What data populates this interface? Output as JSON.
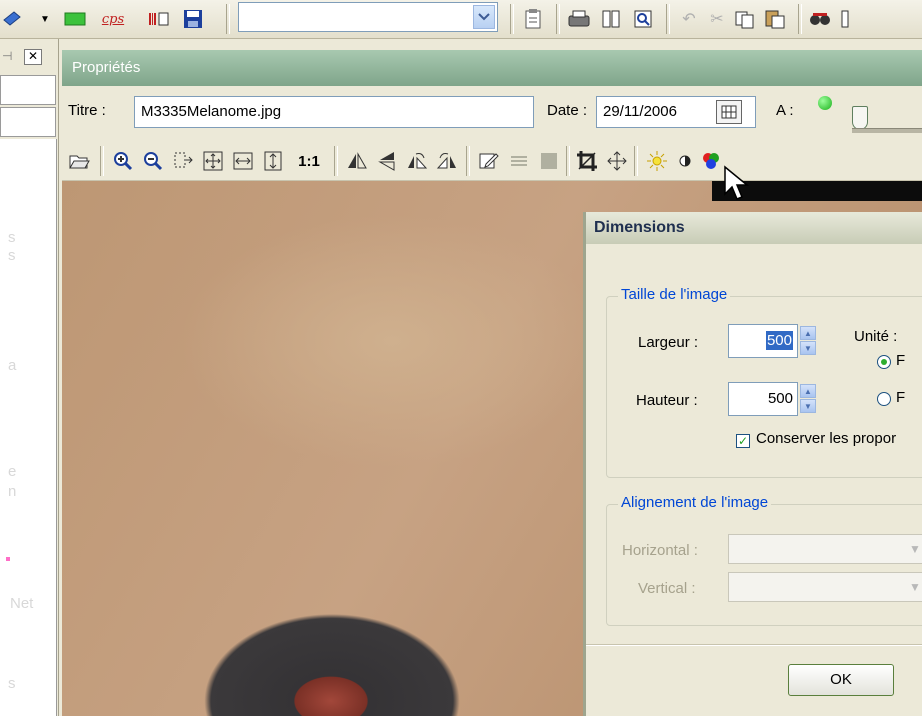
{
  "top_combo": {
    "value": ""
  },
  "properties": {
    "title": "Propriétés",
    "titre_label": "Titre :",
    "titre_value": "M3335Melanome.jpg",
    "date_label": "Date :",
    "date_value": "29/11/2006",
    "a_label": "A :",
    "zoom_label": "1:1"
  },
  "left_panel": {
    "texts": [
      "s",
      "s",
      "a",
      "e",
      "n",
      "Net",
      "s"
    ]
  },
  "dialog": {
    "title": "Dimensions",
    "size_group": "Taille de l'image",
    "largeur_label": "Largeur :",
    "largeur_value": "500",
    "hauteur_label": "Hauteur :",
    "hauteur_value": "500",
    "unite_label": "Unité :",
    "unit_option1": "F",
    "unit_option2": "F",
    "keep_ratio_label": "Conserver les propor",
    "align_group": "Alignement de l'image",
    "horizontal_label": "Horizontal :",
    "vertical_label": "Vertical :",
    "ok_label": "OK"
  },
  "colors": {
    "panel_title_bg": "#8FB49A",
    "accent_blue": "#0046D5",
    "xp_face": "#ECE9D8"
  }
}
